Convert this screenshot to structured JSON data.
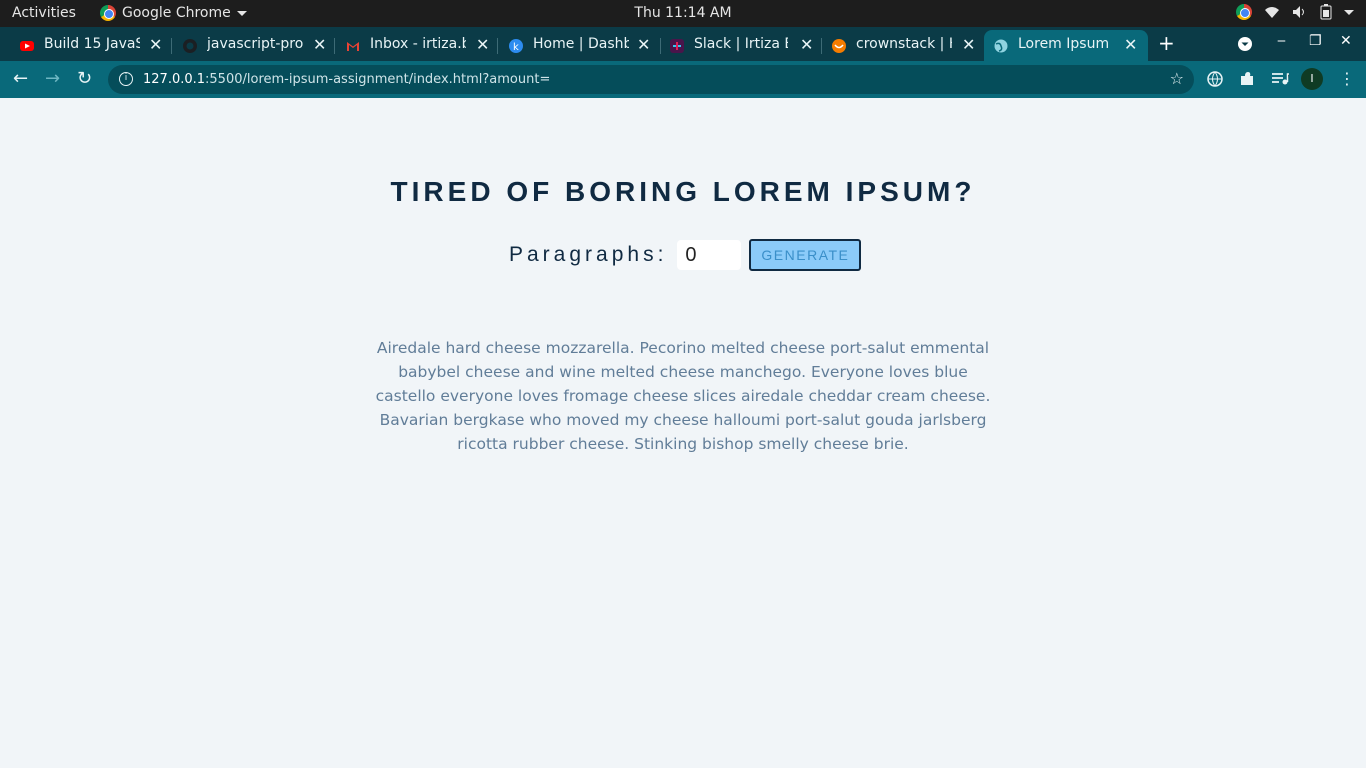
{
  "system": {
    "activities": "Activities",
    "app_name": "Google Chrome",
    "clock": "Thu 11:14 AM"
  },
  "tabs": [
    {
      "label": "Build 15 JavaS",
      "favicon": "youtube-icon"
    },
    {
      "label": "javascript-proj",
      "favicon": "github-icon"
    },
    {
      "label": "Inbox - irtiza.b",
      "favicon": "gmail-icon"
    },
    {
      "label": "Home | Dashbo",
      "favicon": "k-icon"
    },
    {
      "label": "Slack | Irtiza Ba",
      "favicon": "slack-icon"
    },
    {
      "label": "crownstack | H",
      "favicon": "crownstack-icon"
    },
    {
      "label": "Lorem Ipsum",
      "favicon": "globe-icon",
      "active": true
    }
  ],
  "address_bar": {
    "host": "127.0.0.1",
    "path": ":5500/lorem-ipsum-assignment/index.html?amount="
  },
  "profile_initial": "I",
  "page": {
    "title": "TIRED OF BORING LOREM IPSUM?",
    "paragraphs_label": "Paragraphs:",
    "amount_value": "0",
    "generate_label": "GENERATE",
    "lorem_text": "Airedale hard cheese mozzarella. Pecorino melted cheese port-salut emmental babybel cheese and wine melted cheese manchego. Everyone loves blue castello everyone loves fromage cheese slices airedale cheddar cream cheese. Bavarian bergkase who moved my cheese halloumi port-salut gouda jarlsberg ricotta rubber cheese. Stinking bishop smelly cheese brie."
  },
  "colors": {
    "tab_strip": "#0b3b47",
    "toolbar": "#09697a",
    "page_bg": "#f1f5f8",
    "heading": "#102a42",
    "button_bg": "#8bcbf9",
    "lorem_text": "#617d98"
  }
}
